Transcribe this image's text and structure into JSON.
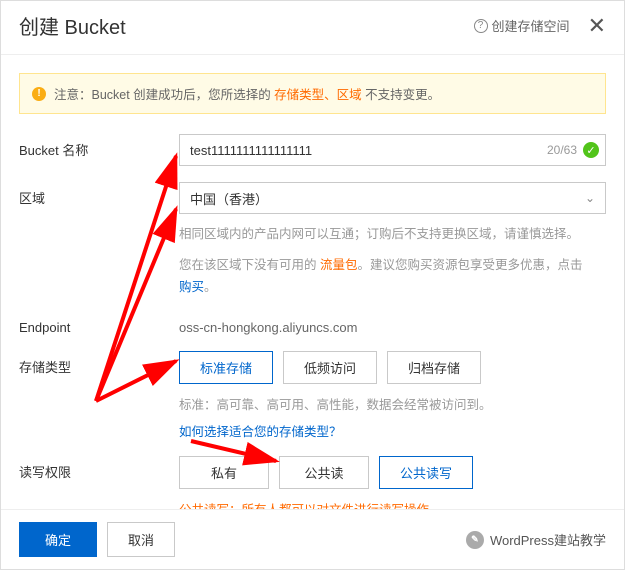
{
  "header": {
    "title": "创建 Bucket",
    "help_label": "创建存储空间"
  },
  "alert": {
    "prefix": "注意：Bucket 创建成功后，您所选择的 ",
    "highlight": "存储类型、区域",
    "suffix": " 不支持变更。"
  },
  "bucket_name": {
    "label": "Bucket 名称",
    "value": "test1111111111111111",
    "count": "20/63"
  },
  "region": {
    "label": "区域",
    "value": "中国（香港）",
    "hint1": "相同区域内的产品内网可以互通；订购后不支持更换区域，请谨慎选择。",
    "hint2_prefix": "您在该区域下没有可用的 ",
    "hint2_orange": "流量包",
    "hint2_mid": "。建议您购买资源包享受更多优惠，点击",
    "hint2_link": "购买",
    "hint2_suffix": "。"
  },
  "endpoint": {
    "label": "Endpoint",
    "value": "oss-cn-hongkong.aliyuncs.com"
  },
  "storage_type": {
    "label": "存储类型",
    "options": [
      "标准存储",
      "低频访问",
      "归档存储"
    ],
    "selected": 0,
    "caption": "标准：高可靠、高可用、高性能，数据会经常被访问到。",
    "link": "如何选择适合您的存储类型？"
  },
  "acl": {
    "label": "读写权限",
    "options": [
      "私有",
      "公共读",
      "公共读写"
    ],
    "selected": 2,
    "warning": "公共读写：所有人都可以对文件进行读写操作。"
  },
  "footer": {
    "ok": "确定",
    "cancel": "取消",
    "credit": "WordPress建站教学"
  }
}
